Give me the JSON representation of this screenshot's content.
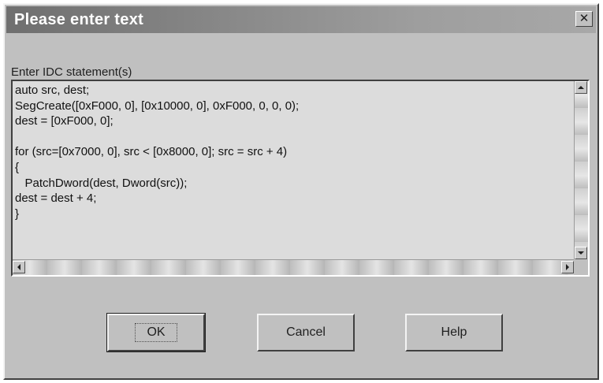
{
  "dialog": {
    "title": "Please enter text",
    "close_glyph": "✕",
    "prompt_label": "Enter IDC statement(s)",
    "code_lines": [
      "auto src, dest;",
      "SegCreate([0xF000, 0], [0x10000, 0], 0xF000, 0, 0, 0);",
      "dest = [0xF000, 0];",
      "",
      "for (src=[0x7000, 0], src < [0x8000, 0]; src = src + 4)",
      "{",
      "   PatchDword(dest, Dword(src));",
      "dest = dest + 4;",
      "}"
    ],
    "buttons": {
      "ok": "OK",
      "cancel": "Cancel",
      "help": "Help"
    }
  },
  "icons": {
    "close": "close-icon",
    "scroll_up": "arrow-up-icon",
    "scroll_down": "arrow-down-icon",
    "scroll_left": "arrow-left-icon",
    "scroll_right": "arrow-right-icon"
  },
  "colors": {
    "face": "#c0c0c0",
    "title_bar": "#7a7a7a",
    "title_text": "#ffffff",
    "editor_bg": "#dcdcdc"
  }
}
